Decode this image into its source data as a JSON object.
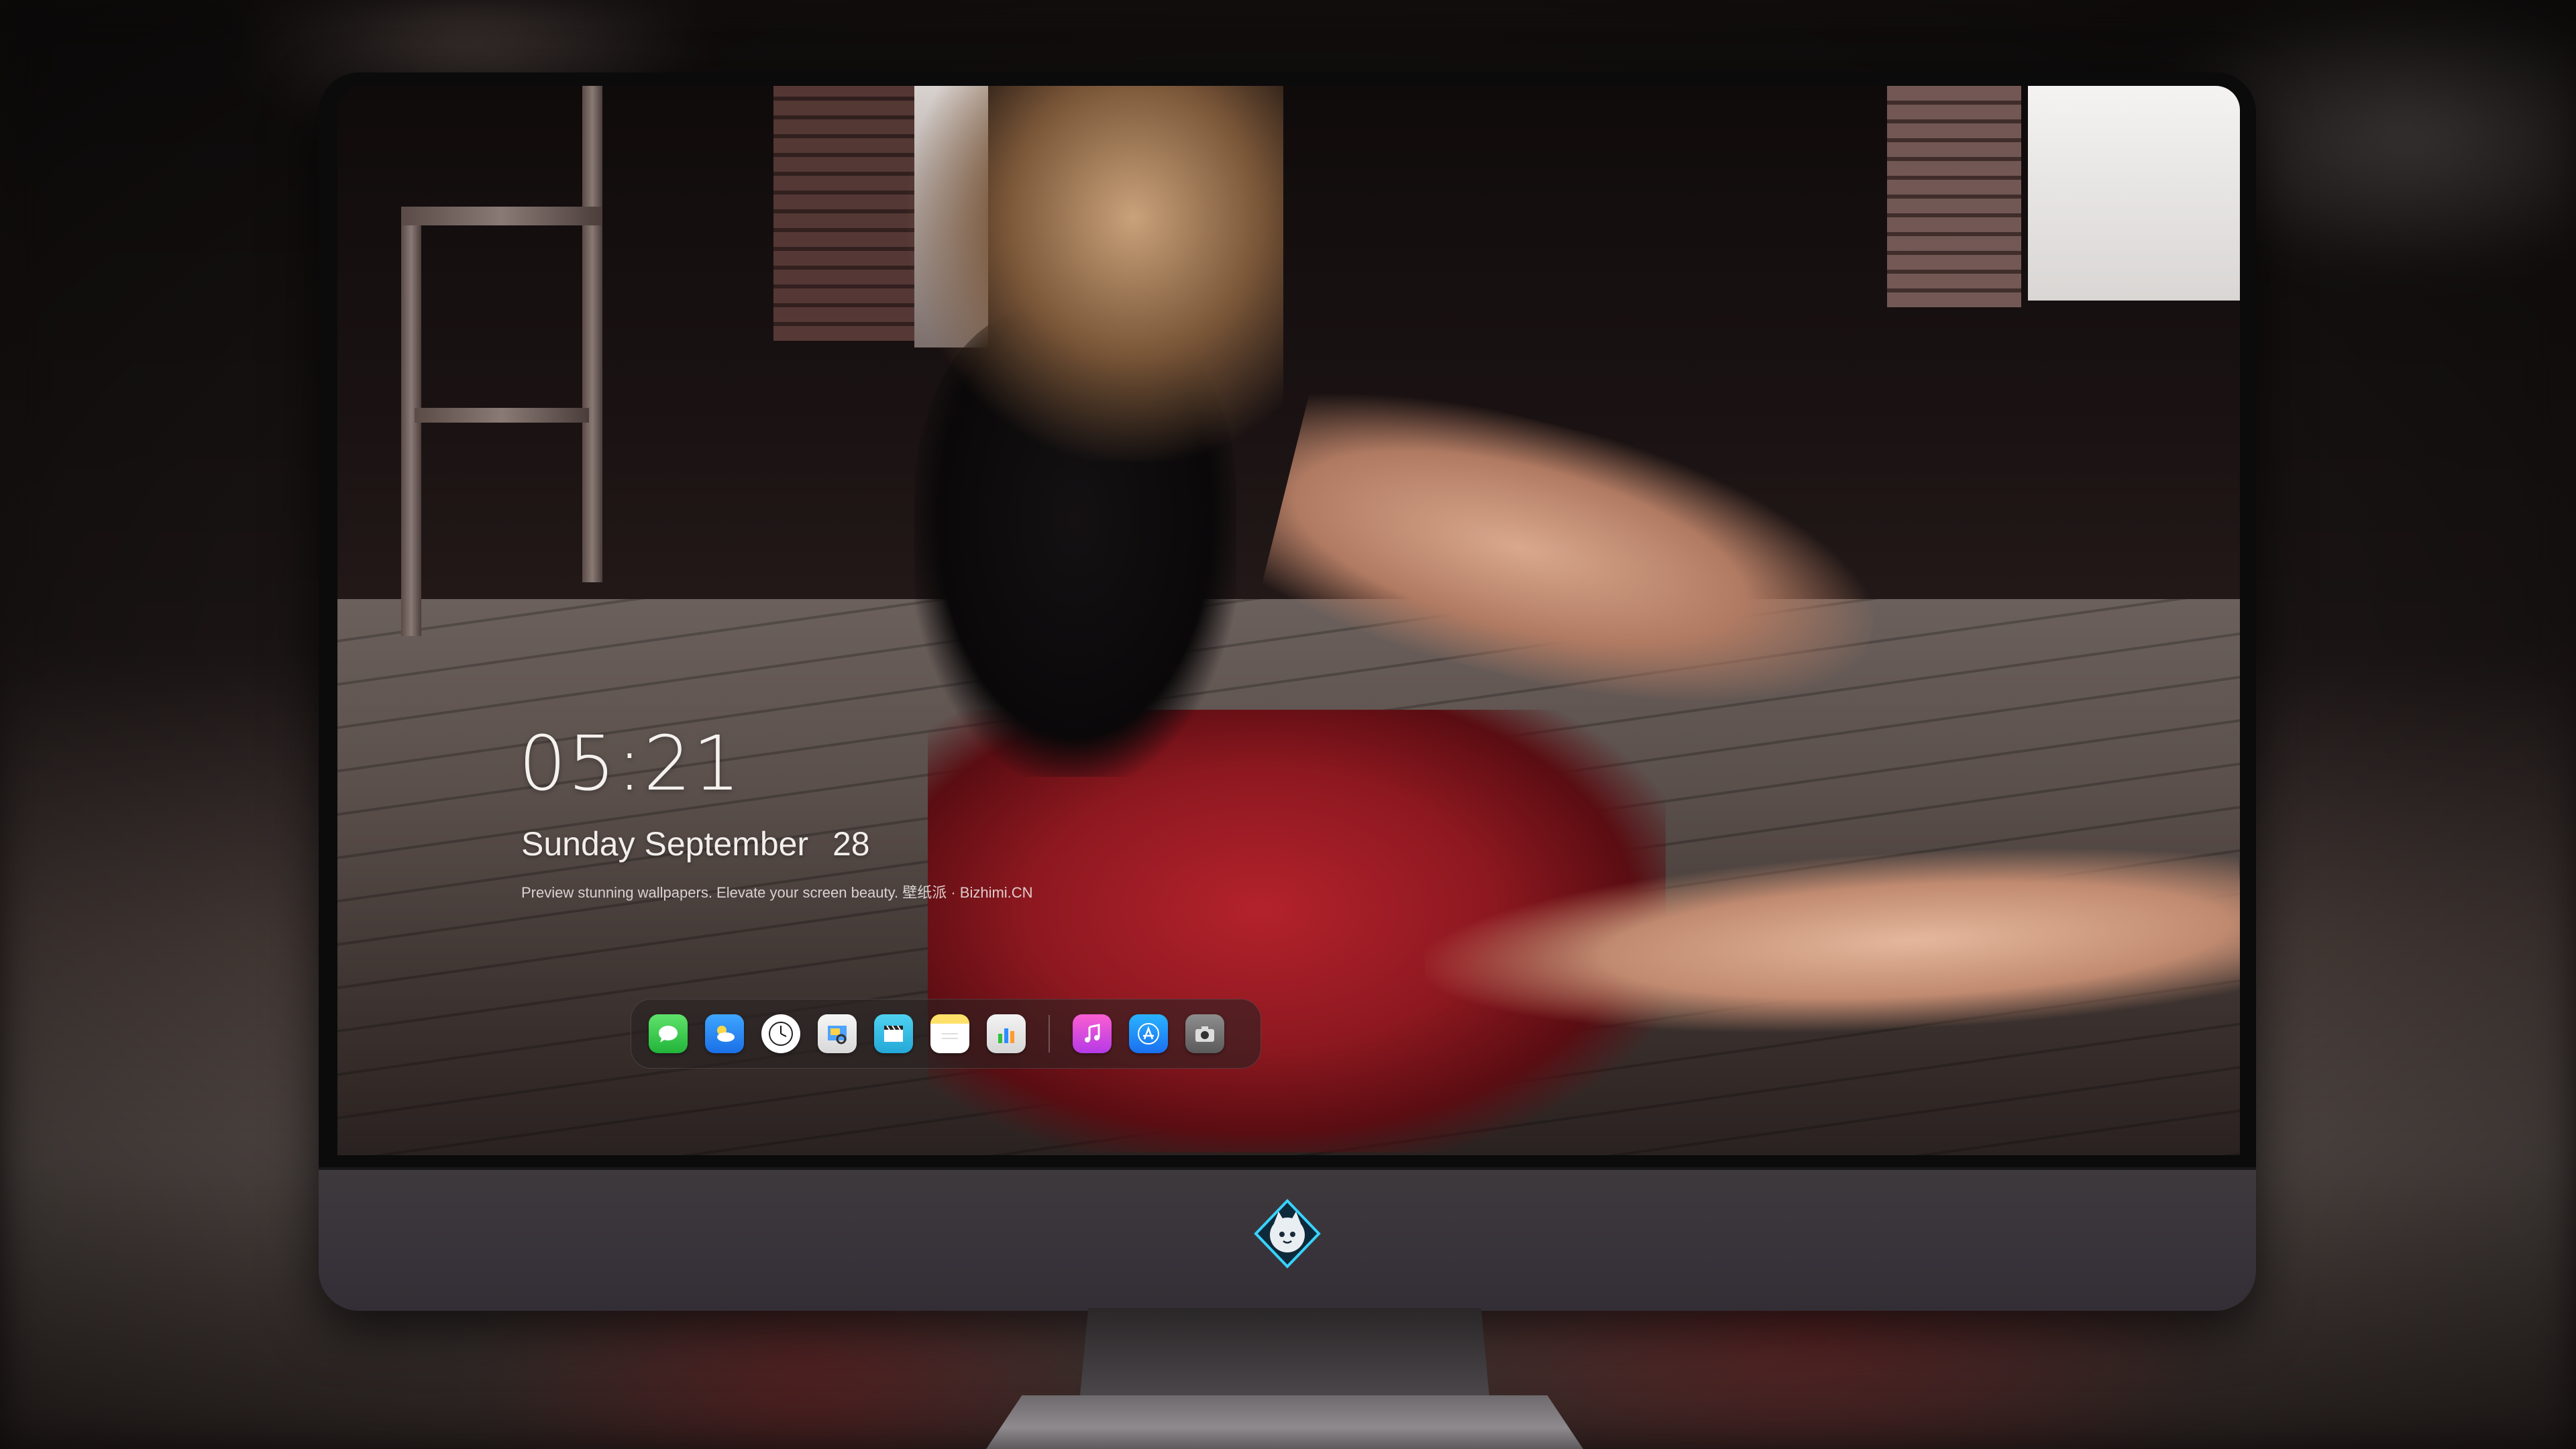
{
  "lock_screen": {
    "time": "05:21",
    "weekday": "Sunday",
    "month": "September",
    "day": "28",
    "caption": "Preview stunning wallpapers. Elevate your screen beauty. 壁纸派 · Bizhimi.CN"
  },
  "dock": {
    "apps": [
      {
        "name": "Messages",
        "icon": "messages-icon"
      },
      {
        "name": "Weather",
        "icon": "weather-icon"
      },
      {
        "name": "Clock",
        "icon": "clock-icon"
      },
      {
        "name": "Preview",
        "icon": "preview-icon"
      },
      {
        "name": "Clips",
        "icon": "clips-icon"
      },
      {
        "name": "Notes",
        "icon": "notes-icon"
      },
      {
        "name": "Numbers",
        "icon": "numbers-icon"
      },
      {
        "name": "Music",
        "icon": "music-icon"
      },
      {
        "name": "App Store",
        "icon": "app-store-icon"
      },
      {
        "name": "Camera",
        "icon": "camera-icon"
      }
    ]
  },
  "monitor": {
    "logo": "fox-mascot-logo"
  },
  "colors": {
    "skirt_red": "#b3222c",
    "bezel": "#0b0b0c",
    "chin": "#3e393c"
  }
}
